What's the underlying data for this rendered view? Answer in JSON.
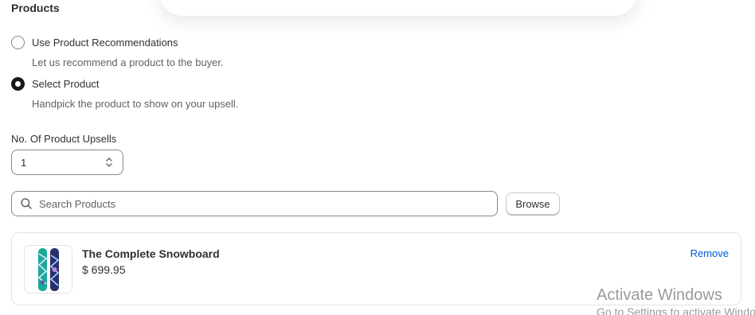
{
  "section": {
    "title": "Products"
  },
  "recommendation_options": [
    {
      "label": "Use Product Recommendations",
      "help": "Let us recommend a product to the buyer.",
      "selected": false
    },
    {
      "label": "Select Product",
      "help": "Handpick the product to show on your upsell.",
      "selected": true
    }
  ],
  "upsell_count": {
    "label": "No. Of Product Upsells",
    "value": "1"
  },
  "search": {
    "placeholder": "Search Products",
    "value": ""
  },
  "browse": {
    "label": "Browse"
  },
  "selected_product": {
    "name": "The Complete Snowboard",
    "price": "$ 699.95",
    "remove_label": "Remove"
  },
  "watermark": {
    "title": "Activate Windows",
    "subtitle": "Go to Settings to activate Windows."
  },
  "colors": {
    "link": "#005bd3",
    "border": "#8a8a8a",
    "text": "#303030",
    "muted": "#616161"
  }
}
